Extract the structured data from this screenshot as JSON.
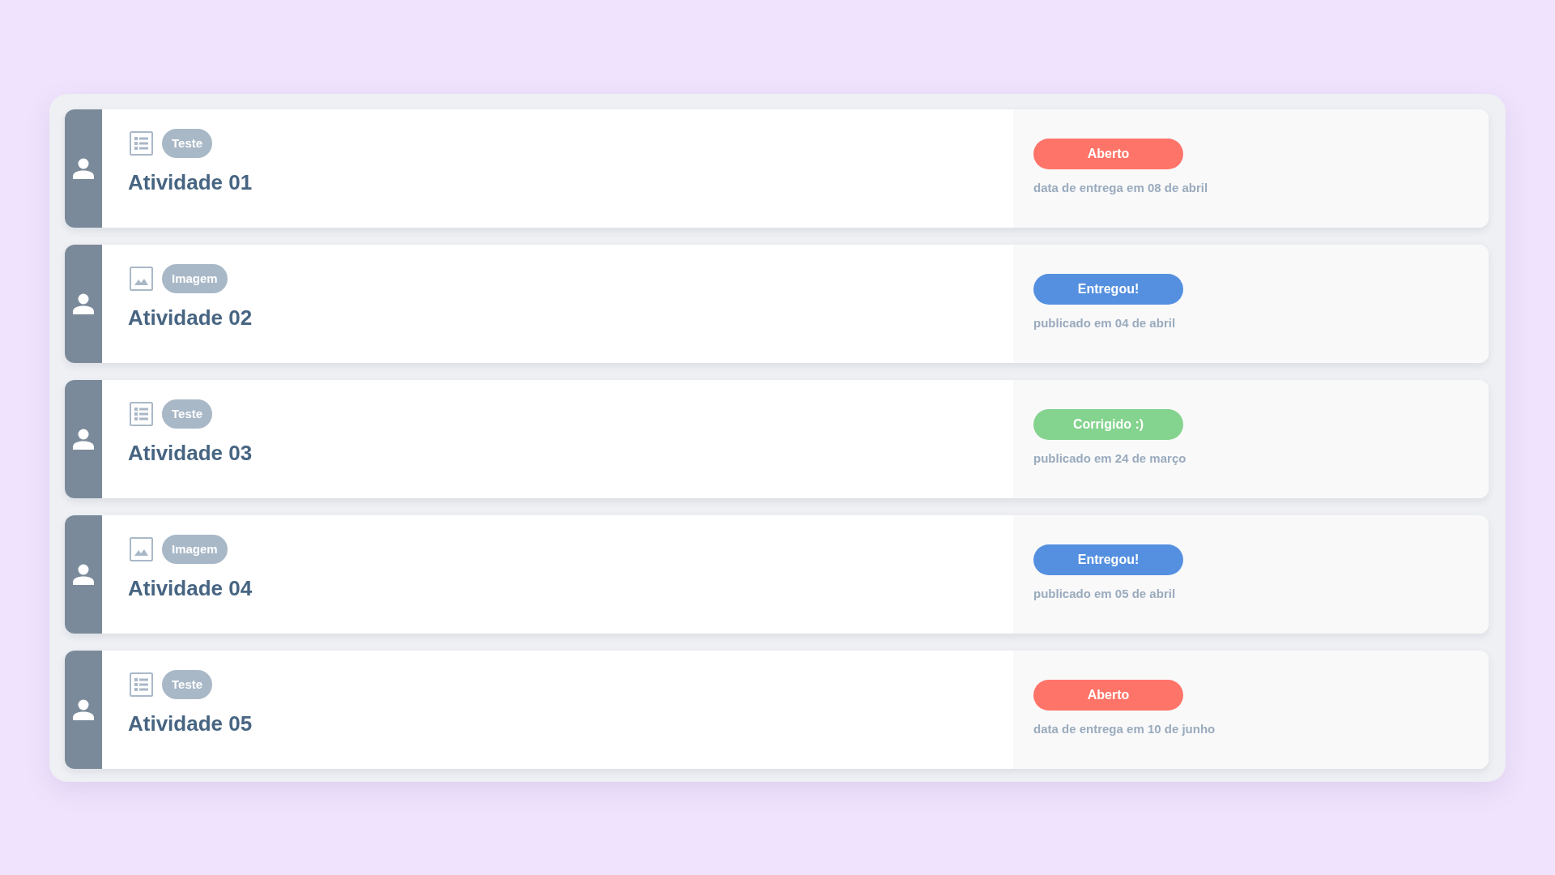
{
  "activities": [
    {
      "type": {
        "kind": "test",
        "label": "Teste"
      },
      "title": "Atividade 01",
      "status": {
        "label": "Aberto",
        "color": "#ff7468"
      },
      "date": "data de entrega em 08 de abril"
    },
    {
      "type": {
        "kind": "image",
        "label": "Imagem"
      },
      "title": "Atividade 02",
      "status": {
        "label": "Entregou!",
        "color": "#5590e0"
      },
      "date": "publicado em 04 de abril"
    },
    {
      "type": {
        "kind": "test",
        "label": "Teste"
      },
      "title": "Atividade 03",
      "status": {
        "label": "Corrigido :)",
        "color": "#84d38e"
      },
      "date": "publicado em 24 de março"
    },
    {
      "type": {
        "kind": "image",
        "label": "Imagem"
      },
      "title": "Atividade 04",
      "status": {
        "label": "Entregou!",
        "color": "#5590e0"
      },
      "date": "publicado em 05 de abril"
    },
    {
      "type": {
        "kind": "test",
        "label": "Teste"
      },
      "title": "Atividade 05",
      "status": {
        "label": "Aberto",
        "color": "#ff7468"
      },
      "date": "data de entrega em 10 de junho"
    }
  ]
}
